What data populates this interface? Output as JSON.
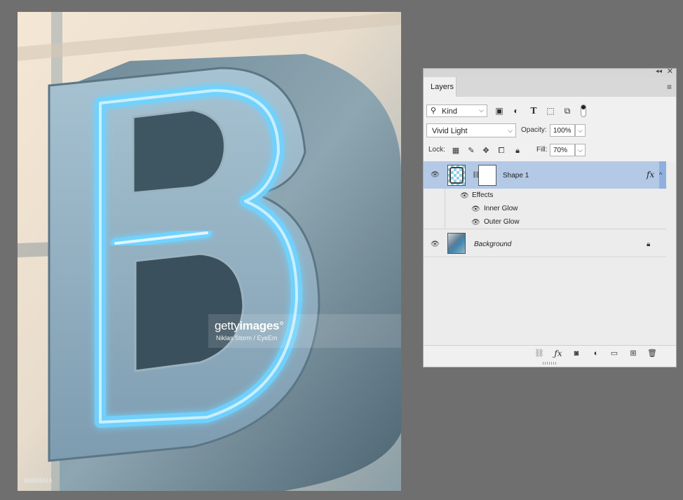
{
  "canvas": {
    "watermark_logo_light": "getty",
    "watermark_logo_bold": "images",
    "watermark_logo_mark": "°",
    "watermark_credit": "Niklas Storm / EyeEm",
    "image_id": "899506616"
  },
  "layers_panel": {
    "tab_label": "Layers",
    "collapse_glyph": "◂◂",
    "close_glyph": "✕",
    "menu_glyph": "≡",
    "filter": {
      "label": "Kind",
      "icon": "search-icon"
    },
    "filter_icons": [
      "image-filter-icon",
      "adjustment-filter-icon",
      "type-filter-icon",
      "shape-filter-icon",
      "smart-object-filter-icon"
    ],
    "blend_mode": "Vivid Light",
    "opacity_label": "Opacity:",
    "opacity_value": "100%",
    "lock_label": "Lock:",
    "fill_label": "Fill:",
    "fill_value": "70%",
    "layers": [
      {
        "name": "Shape 1",
        "selected": true,
        "fx": "fx",
        "visible": true
      },
      {
        "name": "Background",
        "locked": true,
        "visible": true
      }
    ],
    "effects_label": "Effects",
    "effects": [
      "Inner Glow",
      "Outer Glow"
    ],
    "bottom_icons": [
      "link-layers-icon",
      "fx-icon",
      "add-mask-icon",
      "adjustment-layer-icon",
      "new-group-icon",
      "new-layer-icon",
      "delete-icon"
    ],
    "colors": {
      "selected_row": "#b3c9e6",
      "panel_bg": "#f0f0f0",
      "workspace": "#6f6f6f"
    }
  }
}
